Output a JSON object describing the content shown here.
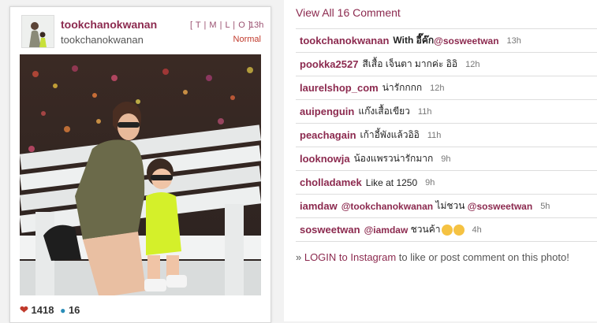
{
  "post": {
    "username": "tookchanokwanan",
    "fullname": "tookchanokwanan",
    "filters": "[ T | M | L | O ]",
    "time": "13h",
    "filter_name": "Normal",
    "likes": "1418",
    "comments_count": "16"
  },
  "comments_panel": {
    "view_all": "View All 16 Comment",
    "items": [
      {
        "user": "tookchanokwanan",
        "text": "With อี๊ค๊ก ",
        "mention": "@sosweetwan",
        "after": "",
        "time": "13h"
      },
      {
        "user": "pookka2527",
        "text": "สีเสื้อ เจ็นตา มากค่ะ อิอิ",
        "mention": "",
        "after": "",
        "time": "12h"
      },
      {
        "user": "laurelshop_com",
        "text": "น่ารักกกก",
        "mention": "",
        "after": "",
        "time": "12h"
      },
      {
        "user": "auipenguin",
        "text": "แก๊งเสื้อเขียว",
        "mention": "",
        "after": "",
        "time": "11h"
      },
      {
        "user": "peachagain",
        "text": "เก้าอี้พังแล้วอิอิ",
        "mention": "",
        "after": "",
        "time": "11h"
      },
      {
        "user": "looknowja",
        "text": "น้องแพรวน่ารักมาก",
        "mention": "",
        "after": "",
        "time": "9h"
      },
      {
        "user": "cholladamek",
        "text": "Like at 1250",
        "mention": "",
        "after": "",
        "time": "9h"
      },
      {
        "user": "iamdaw",
        "text": "",
        "mention": "@tookchanokwanan",
        "after": " ไม่ชวน ",
        "mention2": "@sosweetwan",
        "time": "5h"
      },
      {
        "user": "sosweetwan",
        "text": "",
        "mention": "@iamdaw",
        "after": " ชวนค้า",
        "time": "4h"
      }
    ],
    "login_prefix": "» ",
    "login_link": "LOGIN to Instagram",
    "login_suffix": " to like or post comment on this photo!"
  },
  "colors": {
    "accent": "#8c2a4f",
    "heart": "#c0392b",
    "bubble": "#2a8db8"
  }
}
